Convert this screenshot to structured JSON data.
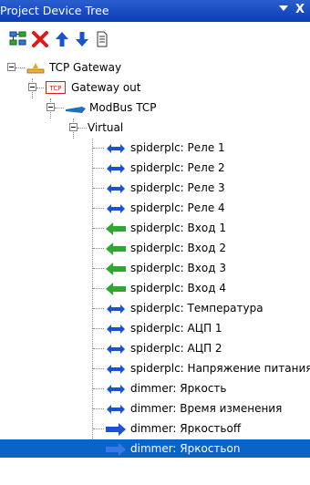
{
  "window": {
    "title": "Project Device Tree",
    "close_label": "X"
  },
  "tree": {
    "root": "TCP Gateway",
    "gateway": "Gateway out",
    "gateway_badge": "TCP",
    "modbus": "ModBus TCP",
    "virtual": "Virtual",
    "items": [
      {
        "label": "spiderplc: Реле 1",
        "icon": "bidirectional-arrow-icon"
      },
      {
        "label": "spiderplc: Реле 2",
        "icon": "bidirectional-arrow-icon"
      },
      {
        "label": "spiderplc: Реле 3",
        "icon": "bidirectional-arrow-icon"
      },
      {
        "label": "spiderplc: Реле 4",
        "icon": "bidirectional-arrow-icon"
      },
      {
        "label": "spiderplc: Вход 1",
        "icon": "left-arrow-icon"
      },
      {
        "label": "spiderplc: Вход 2",
        "icon": "left-arrow-icon"
      },
      {
        "label": "spiderplc: Вход 3",
        "icon": "left-arrow-icon"
      },
      {
        "label": "spiderplc: Вход 4",
        "icon": "left-arrow-icon"
      },
      {
        "label": "spiderplc: Температура",
        "icon": "bidirectional-arrow-icon"
      },
      {
        "label": "spiderplc: АЦП 1",
        "icon": "bidirectional-arrow-icon"
      },
      {
        "label": "spiderplc: АЦП 2",
        "icon": "bidirectional-arrow-icon"
      },
      {
        "label": "spiderplc: Напряжение питания",
        "icon": "bidirectional-arrow-icon"
      },
      {
        "label": "dimmer: Яркость",
        "icon": "bidirectional-arrow-icon"
      },
      {
        "label": "dimmer: Время изменения",
        "icon": "bidirectional-arrow-icon"
      },
      {
        "label": "dimmer: Яркостьoff",
        "icon": "right-arrow-icon"
      },
      {
        "label": "dimmer: Яркостьon",
        "icon": "right-arrow-icon",
        "selected": true
      }
    ]
  },
  "colors": {
    "titlebar": "#0c3cb4",
    "selection": "#0a64c8",
    "arrow_blue": "#1a52d6",
    "arrow_green": "#2fa82f"
  }
}
